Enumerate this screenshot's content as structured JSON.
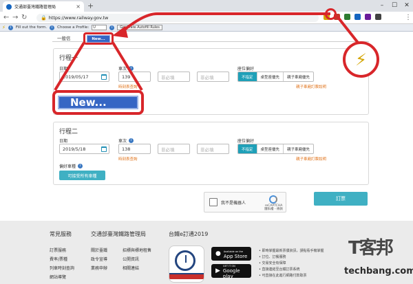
{
  "browser": {
    "tab_title": "交通部臺灣鐵路管理局",
    "tab_close": "×",
    "new_tab": "+",
    "url": "https://www.railway.gov.tw",
    "window_controls": [
      "–",
      "☐",
      "✕"
    ],
    "nav": {
      "back": "←",
      "forward": "→",
      "reload": "↻",
      "home": "⌂",
      "lock": "🔒"
    },
    "extension_colors": [
      "#d4a500",
      "#c0392b",
      "#2e7d32",
      "#1565c0",
      "#6a1b9a",
      "#424242"
    ],
    "menu": "⋮"
  },
  "autofill_bar": {
    "fill_text": "Fill out the form.",
    "choose_profile": "Choose a Profile:",
    "profile_value": "U",
    "generate_button": "Generate Autofill Rules",
    "bolt": "⚡"
  },
  "page": {
    "general_tab": "一般信",
    "new_badge_small": "New...",
    "trip1": {
      "title": "行程一",
      "date_label": "日期",
      "date_value": "2019/05/17",
      "train_label": "車次",
      "train_value": "139",
      "train_placeholder1": "非必填",
      "train_placeholder2": "非必填",
      "time_query": "時刻表查詢",
      "seat_label": "座位偏好",
      "seat_options": [
        "不指定",
        "桌型座優先",
        "親子車廂優先"
      ],
      "family_note": "親子車廂訂票說明"
    },
    "trip2": {
      "title": "行程二",
      "date_label": "日期",
      "date_value": "2019/5/18",
      "train_label": "車次",
      "train_value": "138",
      "train_placeholder1": "非必填",
      "train_placeholder2": "非必填",
      "time_query": "時刻表查詢",
      "seat_label": "座位偏好",
      "seat_options": [
        "不指定",
        "桌型座優先",
        "親子車廂優先"
      ],
      "family_note": "親子車廂訂票說明",
      "pref_label": "偏好車種",
      "pref_button": "可接受所有車種"
    },
    "captcha": {
      "text": "我不是機器人",
      "brand": "reCAPTCHA",
      "terms": "隱私權 - 條款"
    },
    "order_button": "訂票",
    "info_icon": "i"
  },
  "footer": {
    "headings": [
      "常見服務",
      "交通部臺灣鐵路管理局",
      "台鐵e訂通2019"
    ],
    "links_col1": [
      "訂票服務",
      "費率/票種",
      "列車時刻查詢",
      "網站導覽"
    ],
    "links_col2": [
      "關於臺鐵",
      "政令宣導",
      "業務申辦"
    ],
    "links_col3": [
      "招標與標地租售",
      "公開資訊",
      "相關連結"
    ],
    "app_store": {
      "small": "Available on the",
      "big": "App Store"
    },
    "google_play": {
      "small": "GET IT ON",
      "big": "Google play"
    },
    "bullets": [
      "• 即時掌握最新票價資訊，誤點看手機掌握",
      "• 訂位、訂餐服務",
      "• 交易安全有保障",
      "• 直接連結至台鐵訂票系統",
      "• 可直接在此進行網路付款取票"
    ]
  },
  "overlay": {
    "new_magnified": "New...",
    "bolt_magnified": "⚡"
  },
  "watermark": {
    "big": "T客邦",
    "small": "techbang.com"
  }
}
